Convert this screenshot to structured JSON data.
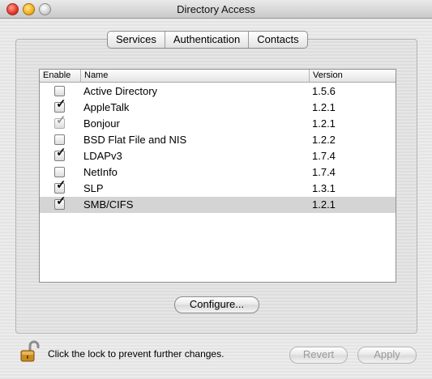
{
  "window": {
    "title": "Directory Access"
  },
  "tabs": [
    {
      "label": "Services"
    },
    {
      "label": "Authentication"
    },
    {
      "label": "Contacts"
    }
  ],
  "table": {
    "columns": {
      "enable": "Enable",
      "name": "Name",
      "version": "Version"
    },
    "rows": [
      {
        "name": "Active Directory",
        "version": "1.5.6",
        "enabled": false,
        "dimmed": false,
        "selected": false
      },
      {
        "name": "AppleTalk",
        "version": "1.2.1",
        "enabled": true,
        "dimmed": false,
        "selected": false
      },
      {
        "name": "Bonjour",
        "version": "1.2.1",
        "enabled": true,
        "dimmed": true,
        "selected": false
      },
      {
        "name": "BSD Flat File and NIS",
        "version": "1.2.2",
        "enabled": false,
        "dimmed": false,
        "selected": false
      },
      {
        "name": "LDAPv3",
        "version": "1.7.4",
        "enabled": true,
        "dimmed": false,
        "selected": false
      },
      {
        "name": "NetInfo",
        "version": "1.7.4",
        "enabled": false,
        "dimmed": false,
        "selected": false
      },
      {
        "name": "SLP",
        "version": "1.3.1",
        "enabled": true,
        "dimmed": false,
        "selected": false
      },
      {
        "name": "SMB/CIFS",
        "version": "1.2.1",
        "enabled": true,
        "dimmed": false,
        "selected": true
      }
    ]
  },
  "buttons": {
    "configure": "Configure...",
    "revert": "Revert",
    "apply": "Apply"
  },
  "footer": {
    "lock_text": "Click the lock to prevent further changes."
  },
  "icons": {
    "lock": "unlocked-padlock-icon",
    "checkmark": "checkmark-icon"
  }
}
